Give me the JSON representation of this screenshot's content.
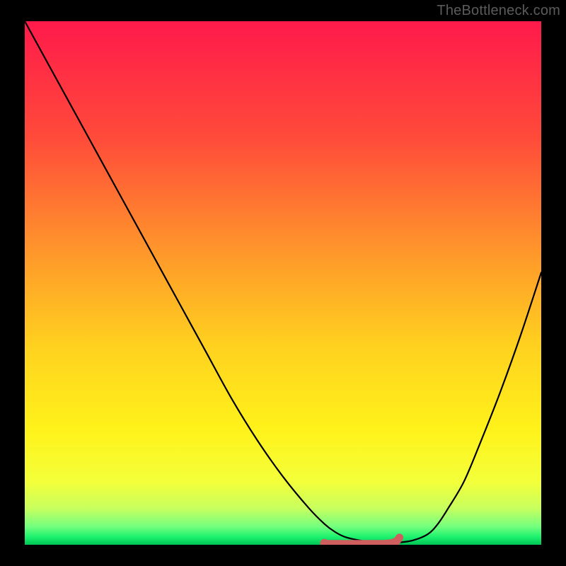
{
  "watermark": "TheBottleneck.com",
  "chart_data": {
    "type": "line",
    "title": "",
    "xlabel": "",
    "ylabel": "",
    "xlim": [
      0,
      100
    ],
    "ylim": [
      0,
      100
    ],
    "series": [
      {
        "name": "curve",
        "color": "#000000",
        "x": [
          0,
          5,
          10,
          15,
          20,
          25,
          30,
          35,
          40,
          45,
          50,
          55,
          58,
          60,
          62,
          65,
          68,
          70,
          72,
          75,
          78,
          80,
          82,
          85,
          88,
          92,
          96,
          100
        ],
        "y": [
          100,
          91,
          82,
          73,
          64,
          55,
          46,
          37,
          28,
          20,
          13,
          7,
          4,
          2.5,
          1.5,
          0.8,
          0.4,
          0.3,
          0.4,
          0.8,
          2,
          4,
          7,
          12,
          19,
          29,
          40,
          52
        ]
      },
      {
        "name": "flat-marker",
        "color": "#cf5e5e",
        "x": [
          58,
          72
        ],
        "y": [
          0.3,
          0.3
        ],
        "style": "thick-segment-with-round-caps"
      }
    ],
    "gradient": {
      "stops": [
        {
          "offset": 0.0,
          "color": "#ff1a4b"
        },
        {
          "offset": 0.22,
          "color": "#ff4a3a"
        },
        {
          "offset": 0.45,
          "color": "#ff9a2a"
        },
        {
          "offset": 0.62,
          "color": "#ffd11f"
        },
        {
          "offset": 0.78,
          "color": "#fff21a"
        },
        {
          "offset": 0.88,
          "color": "#f3ff3a"
        },
        {
          "offset": 0.93,
          "color": "#c8ff5e"
        },
        {
          "offset": 0.965,
          "color": "#74ff7e"
        },
        {
          "offset": 0.985,
          "color": "#1cf26e"
        },
        {
          "offset": 1.0,
          "color": "#00c455"
        }
      ]
    }
  }
}
